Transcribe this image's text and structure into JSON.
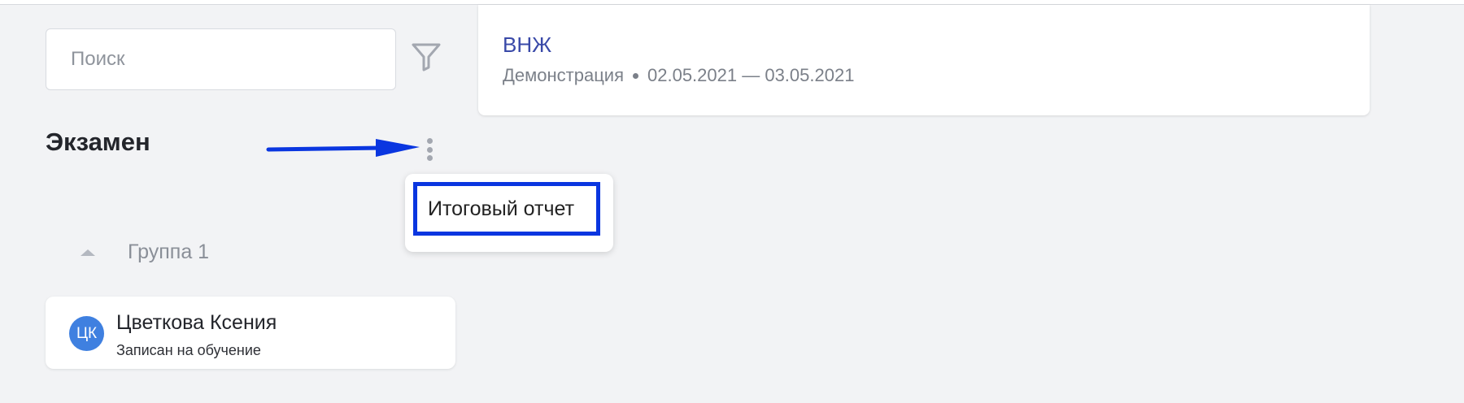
{
  "search": {
    "placeholder": "Поиск"
  },
  "course": {
    "title": "ВНЖ",
    "type": "Демонстрация",
    "dates": "02.05.2021 — 03.05.2021"
  },
  "section": {
    "title": "Экзамен"
  },
  "menu": {
    "items": [
      {
        "label": "Итоговый отчет"
      }
    ]
  },
  "group": {
    "label": "Группа 1"
  },
  "student": {
    "initials": "ЦК",
    "name": "Цветкова Ксения",
    "status": "Записан на обучение"
  },
  "icons": {
    "filter": "filter-icon",
    "more": "more-vertical-icon",
    "collapse": "caret-up-icon",
    "annotation": "annotation-arrow-icon"
  },
  "colors": {
    "background": "#f2f3f5",
    "link": "#3949a8",
    "avatar": "#3f80e0",
    "highlight": "#0a36e0",
    "annotation_arrow": "#0a36e0"
  }
}
